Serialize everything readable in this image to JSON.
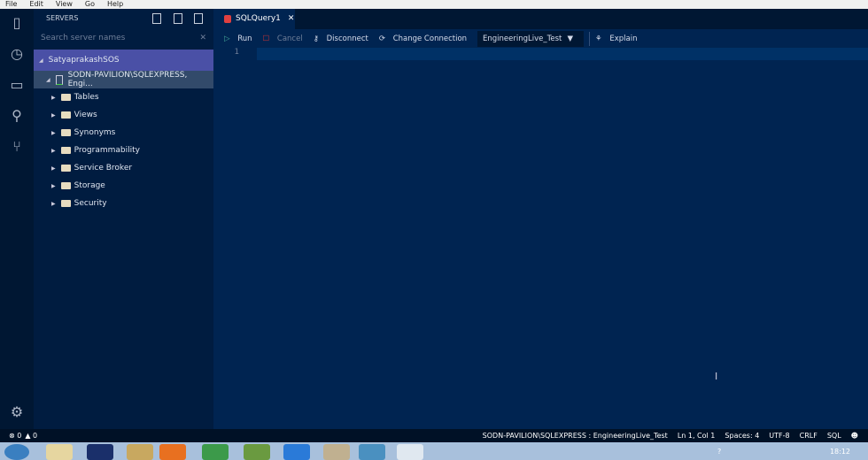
{
  "menu": [
    "File",
    "Edit",
    "View",
    "Go",
    "Help"
  ],
  "sidebar": {
    "title": "SERVERS",
    "search_placeholder": "Search server names",
    "server_group": "SatyaprakashSOS",
    "connection": "SODN-PAVILION\\SQLEXPRESS, Engi...",
    "folders": [
      "Tables",
      "Views",
      "Synonyms",
      "Programmability",
      "Service Broker",
      "Storage",
      "Security"
    ]
  },
  "tab": {
    "label": "SQLQuery1"
  },
  "toolbar": {
    "run": "Run",
    "cancel": "Cancel",
    "disconnect": "Disconnect",
    "change_connection": "Change Connection",
    "database": "EngineeringLive_Test",
    "explain": "Explain"
  },
  "editor": {
    "line_number": "1"
  },
  "status": {
    "errors": "0",
    "warnings": "0",
    "connection": "SODN-PAVILION\\SQLEXPRESS : EngineeringLive_Test",
    "position": "Ln 1, Col 1",
    "spaces": "Spaces: 4",
    "encoding": "UTF-8",
    "eol": "CRLF",
    "language": "SQL"
  },
  "tray": {
    "time": "18:12"
  }
}
